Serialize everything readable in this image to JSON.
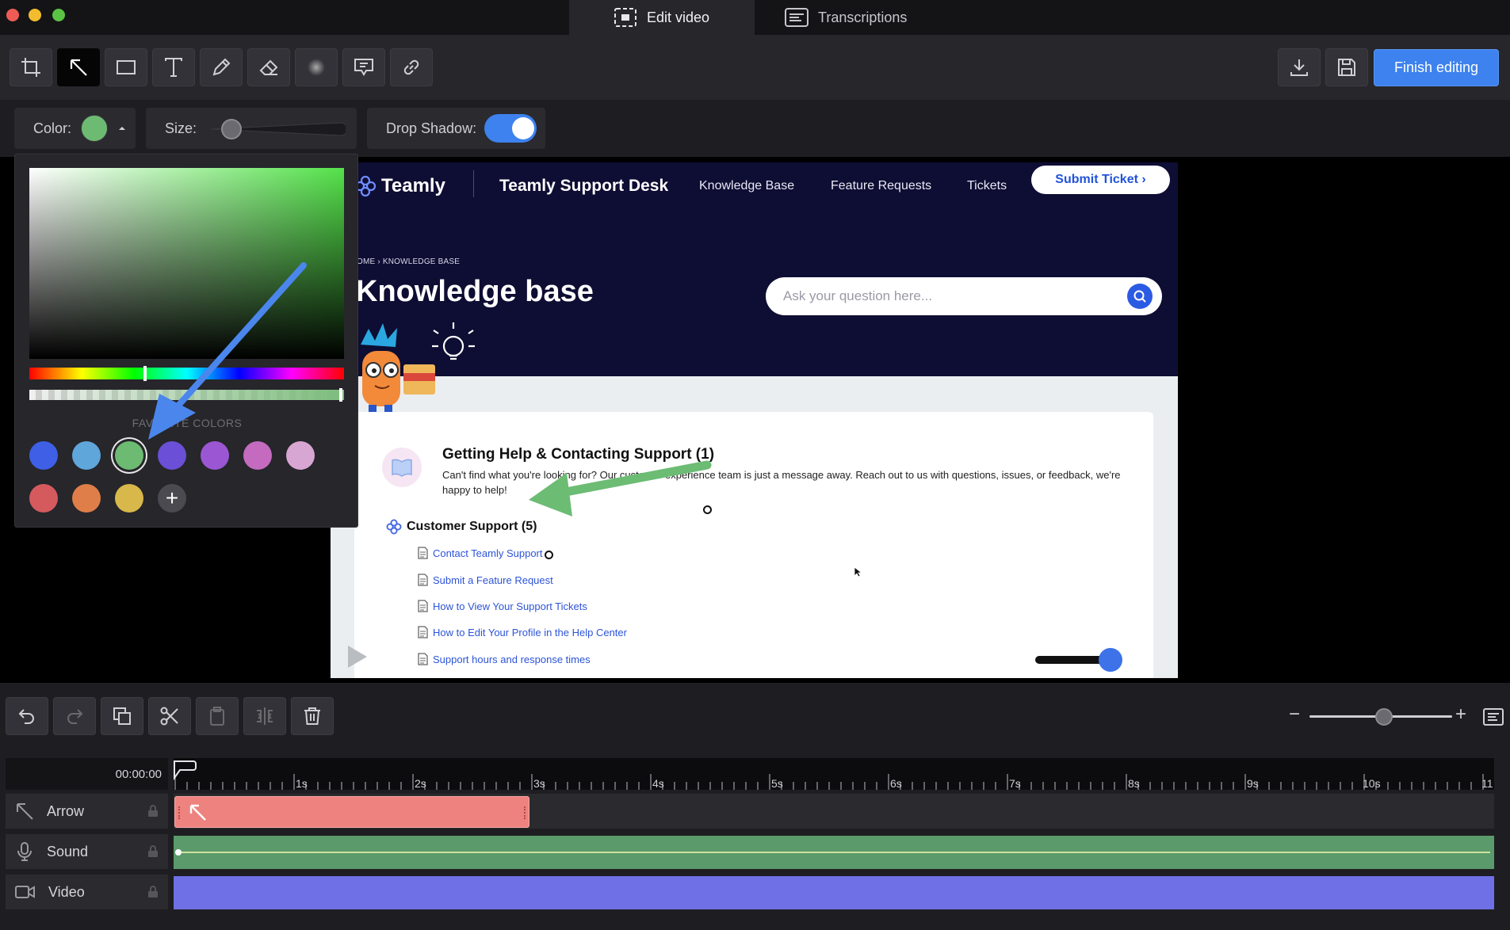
{
  "window": {
    "tabs": [
      {
        "label": "Edit video",
        "icon": "edit-video-icon",
        "active": true
      },
      {
        "label": "Transcriptions",
        "icon": "transcriptions-icon",
        "active": false
      }
    ]
  },
  "toolbar": {
    "tools": [
      "crop-icon",
      "arrow-icon",
      "rectangle-icon",
      "text-icon",
      "pencil-icon",
      "eraser-icon",
      "blur-icon",
      "callout-icon",
      "link-icon"
    ],
    "active_tool": "arrow-icon",
    "download_icon": "download-icon",
    "save_icon": "save-icon",
    "finish_label": "Finish editing"
  },
  "properties": {
    "color_label": "Color:",
    "color_value": "#6dbb72",
    "size_label": "Size:",
    "size_level": 0.2,
    "shadow_label": "Drop Shadow:",
    "shadow_on": true
  },
  "color_picker": {
    "favorites_label": "FAVORITE COLORS",
    "swatches": [
      "#3e5fe6",
      "#5fa6db",
      "#6dbb72",
      "#6b4fd6",
      "#9b57d3",
      "#c46bbf",
      "#d8a6d3",
      "#d55a5e",
      "#df7e48",
      "#d8b84a"
    ],
    "selected_swatch": "#6dbb72",
    "add_label": "+"
  },
  "video": {
    "brand": "Teamly",
    "desk_title": "Teamly Support Desk",
    "nav": [
      "Knowledge Base",
      "Feature Requests",
      "Tickets"
    ],
    "submit_label": "Submit Ticket ›",
    "breadcrumb": "OME  ›  KNOWLEDGE BASE",
    "page_title": "Knowledge base",
    "search_placeholder": "Ask your question here...",
    "section_title": "Getting Help & Contacting Support (1)",
    "section_desc": "Can't find what you're looking for? Our customer experience team is just a message away. Reach out to us with questions, issues, or feedback, we're happy to help!",
    "subsection_title": "Customer Support (5)",
    "articles": [
      "Contact Teamly Support",
      "Submit a Feature Request",
      "How to View Your Support Tickets",
      "How to Edit Your Profile in the Help Center",
      "Support hours and response times"
    ]
  },
  "edit_tools": [
    "undo-icon",
    "redo-icon",
    "duplicate-icon",
    "scissors-icon",
    "clipboard-icon",
    "split-icon",
    "trash-icon"
  ],
  "zoom": {
    "minus": "−",
    "plus": "+",
    "level": 0.6
  },
  "timeline": {
    "timecode": "00:00:00",
    "ticks": [
      "1s",
      "2s",
      "3s",
      "4s",
      "5s",
      "6s",
      "7s",
      "8s",
      "9s",
      "10s",
      "11"
    ],
    "tracks": [
      {
        "label": "Arrow",
        "icon": "arrow-track-icon"
      },
      {
        "label": "Sound",
        "icon": "microphone-icon"
      },
      {
        "label": "Video",
        "icon": "camera-icon"
      }
    ]
  }
}
